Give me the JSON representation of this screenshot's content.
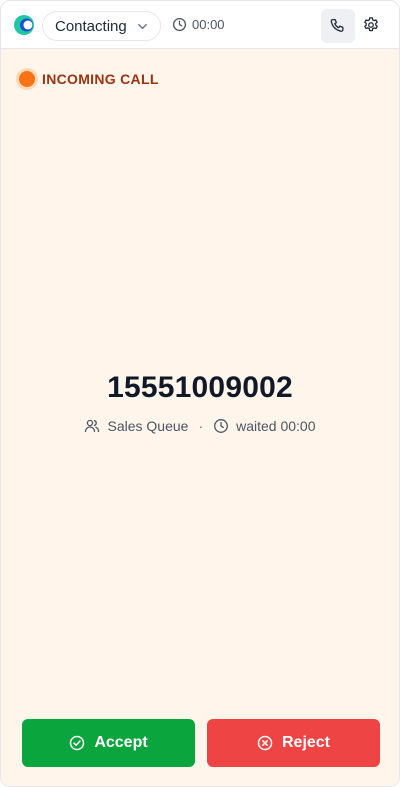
{
  "header": {
    "status_label": "Contacting",
    "timer_value": "00:00",
    "icons": [
      "app-logo",
      "chevron-down-icon",
      "clock-icon",
      "phone-icon",
      "gear-icon"
    ]
  },
  "incoming": {
    "label": "INCOMING CALL",
    "indicator_color": "#f97316"
  },
  "caller": {
    "number": "15551009002",
    "queue": "Sales Queue",
    "separator": "·",
    "waited": "waited 00:00"
  },
  "actions": {
    "accept_label": "Accept",
    "reject_label": "Reject",
    "accept_color": "#0aa53d",
    "reject_color": "#ef4444"
  }
}
